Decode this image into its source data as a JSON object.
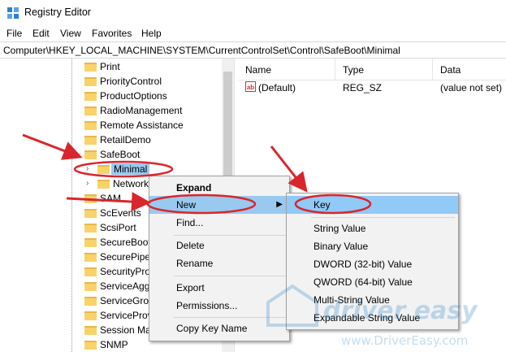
{
  "window": {
    "title": "Registry Editor"
  },
  "menubar": {
    "items": [
      "File",
      "Edit",
      "View",
      "Favorites",
      "Help"
    ]
  },
  "address": {
    "path": "Computer\\HKEY_LOCAL_MACHINE\\SYSTEM\\CurrentControlSet\\Control\\SafeBoot\\Minimal"
  },
  "tree": {
    "items": [
      {
        "label": "Print"
      },
      {
        "label": "PriorityControl"
      },
      {
        "label": "ProductOptions"
      },
      {
        "label": "RadioManagement"
      },
      {
        "label": "Remote Assistance"
      },
      {
        "label": "RetailDemo"
      },
      {
        "label": "SafeBoot"
      },
      {
        "label": "Minimal"
      },
      {
        "label": "Network"
      },
      {
        "label": "SAM"
      },
      {
        "label": "ScEvents"
      },
      {
        "label": "ScsiPort"
      },
      {
        "label": "SecureBoot"
      },
      {
        "label": "SecurePipe"
      },
      {
        "label": "SecurityPro"
      },
      {
        "label": "ServiceAgg"
      },
      {
        "label": "ServiceGrou"
      },
      {
        "label": "ServiceProv"
      },
      {
        "label": "Session Ma"
      },
      {
        "label": "SNMP"
      }
    ]
  },
  "list": {
    "columns": [
      "Name",
      "Type",
      "Data"
    ],
    "rows": [
      {
        "name": "(Default)",
        "type": "REG_SZ",
        "data": "(value not set)"
      }
    ]
  },
  "context_menu": {
    "items": [
      "Expand",
      "New",
      "Find...",
      "Delete",
      "Rename",
      "Export",
      "Permissions...",
      "Copy Key Name"
    ]
  },
  "submenu": {
    "items": [
      "Key",
      "String Value",
      "Binary Value",
      "DWORD (32-bit) Value",
      "QWORD (64-bit) Value",
      "Multi-String Value",
      "Expandable String Value"
    ]
  },
  "watermark": {
    "brand": "driver easy",
    "url": "www.DriverEasy.com"
  },
  "colors": {
    "highlight": "#99c9ef",
    "annotation": "#d9262c",
    "folder": "#f8d36a"
  }
}
